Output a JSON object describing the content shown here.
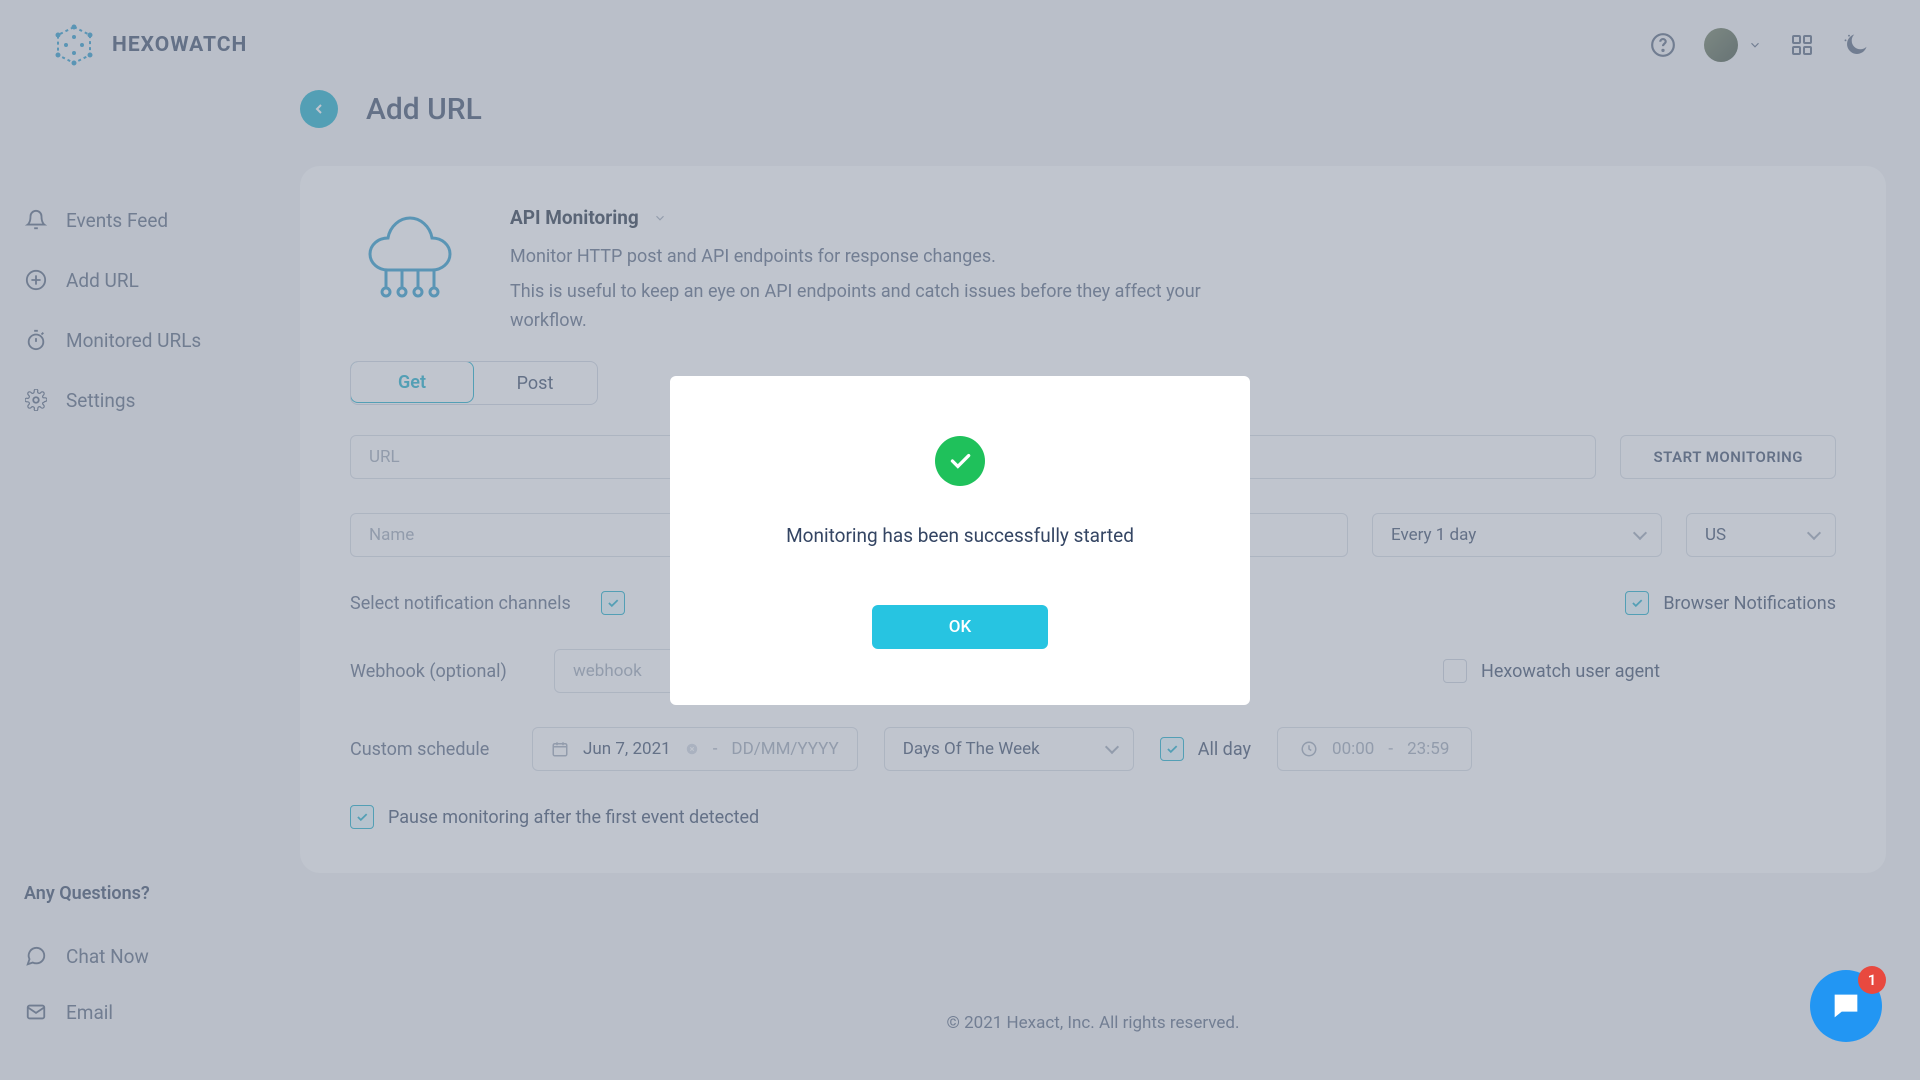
{
  "brand": {
    "name": "HEXOWATCH"
  },
  "topbar": {
    "notifications_badge": "1"
  },
  "sidebar": {
    "items": [
      {
        "label": "Events Feed",
        "icon": "bell"
      },
      {
        "label": "Add URL",
        "icon": "plus-circle"
      },
      {
        "label": "Monitored URLs",
        "icon": "stopwatch"
      },
      {
        "label": "Settings",
        "icon": "gear"
      }
    ],
    "any_questions": "Any Questions?",
    "chat_now": "Chat Now",
    "email": "Email"
  },
  "page": {
    "title": "Add URL"
  },
  "monitor": {
    "title": "API Monitoring",
    "desc1": "Monitor HTTP post and API endpoints for response changes.",
    "desc2": "This is useful to keep an eye on API endpoints and catch issues before they affect your workflow.",
    "methods": {
      "get": "Get",
      "post": "Post"
    },
    "url_placeholder": "URL",
    "start_button": "START MONITORING",
    "name_placeholder": "Name",
    "interval": "Every 1 day",
    "region": "US",
    "notif_label": "Select notification channels",
    "notif_browser_label": "Browser Notifications",
    "webhook_label": "Webhook (optional)",
    "webhook_placeholder": "webhook",
    "useragent_label": "Hexowatch user agent",
    "schedule_label": "Custom schedule",
    "date_start": "Jun 7, 2021",
    "date_sep": "-",
    "date_end_placeholder": "DD/MM/YYYY",
    "days_label": "Days Of The Week",
    "all_day_label": "All day",
    "time_start": "00:00",
    "time_sep": "-",
    "time_end": "23:59",
    "pause_label": "Pause monitoring after the first event detected"
  },
  "footer": {
    "copyright": "© 2021 Hexact, Inc. All rights reserved."
  },
  "modal": {
    "message": "Monitoring has been successfully started",
    "ok": "OK"
  },
  "colors": {
    "accent": "#0fabc8",
    "success": "#1fc15b",
    "chat": "#2296f3"
  }
}
